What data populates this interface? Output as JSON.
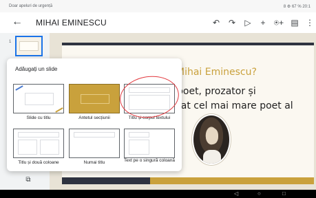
{
  "status_bar": {
    "left": "Doar apeluri de urgență",
    "right": "8 ⚙ 67 % 20:1"
  },
  "app_bar": {
    "title": "MIHAI EMINESCU",
    "back_icon": "arrow-left-icon",
    "tools": [
      "undo-icon",
      "redo-icon",
      "play-icon",
      "add-icon",
      "share-icon",
      "comment-icon",
      "more-icon"
    ],
    "glyphs": {
      "back": "←",
      "undo": "↶",
      "redo": "↷",
      "play": "▷",
      "add": "+",
      "share": "⍟+",
      "comment": "▤",
      "more": "⋮"
    }
  },
  "sidebar": {
    "slide_number": "1",
    "add_slide_glyph": "⧉"
  },
  "slide": {
    "title": "Mihai Eminescu?",
    "lines": [
      "poet, prozator și",
      "rat cel mai mare poet al"
    ]
  },
  "layout_panel": {
    "heading": "Adăugați un slide",
    "layouts": [
      {
        "label": "Slide cu titlu"
      },
      {
        "label": "Antetul secțiunii"
      },
      {
        "label": "Titlu și corpul textului"
      },
      {
        "label": "Titlu și două coloane"
      },
      {
        "label": "Numai titlu"
      },
      {
        "label": "Text pe o singură coloană"
      }
    ]
  },
  "nav_bar": {
    "back": "◁",
    "home": "○",
    "recent": "□"
  },
  "colors": {
    "accent": "#1a73e8",
    "gold": "#c9a13c",
    "dark": "#2e3340",
    "annotation_red": "#e2373d"
  }
}
